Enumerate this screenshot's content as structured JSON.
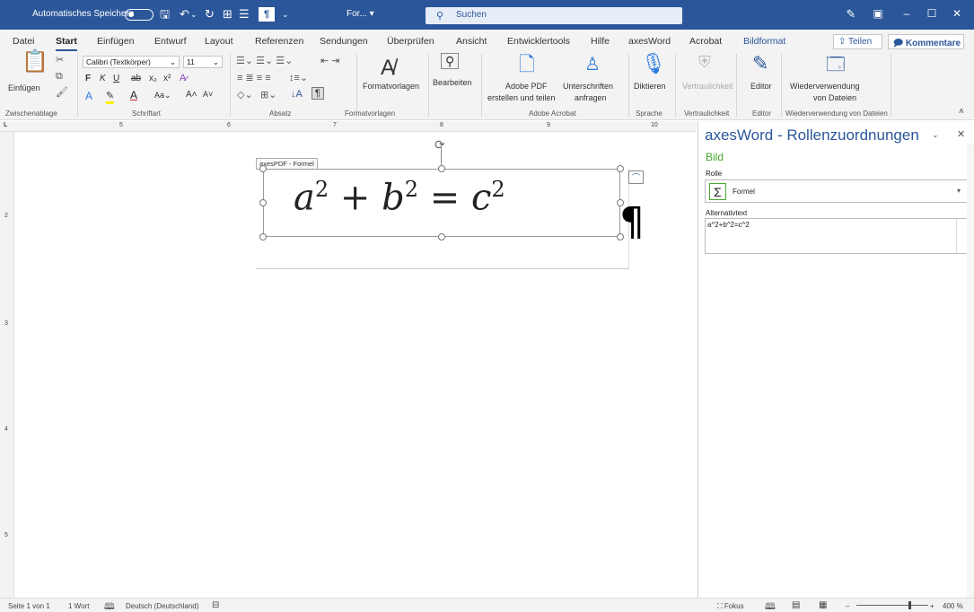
{
  "titlebar": {
    "autosave_label": "Automatisches Speichern",
    "doc_name": "For...",
    "search_placeholder": "Suchen",
    "save_icon": "save-icon",
    "undo_icon": "undo-icon",
    "redo_icon": "redo-icon"
  },
  "tabs": {
    "items": [
      "Datei",
      "Start",
      "Einfügen",
      "Entwurf",
      "Layout",
      "Referenzen",
      "Sendungen",
      "Überprüfen",
      "Ansicht",
      "Entwicklertools",
      "Hilfe",
      "axesWord",
      "Acrobat",
      "Bildformat"
    ],
    "share": "Teilen",
    "comments": "Kommentare"
  },
  "ribbon": {
    "paste": "Einfügen",
    "font_name": "Calibri (Textkörper)",
    "font_size": "11",
    "format_templates": "Formatvorlagen",
    "edit": "Bearbeiten",
    "adobe_pdf": "Adobe PDF",
    "adobe_pdf2": "erstellen und teilen",
    "sign": "Unterschriften",
    "sign2": "anfragen",
    "dictate": "Diktieren",
    "confidential": "Vertraulichkeit",
    "editor": "Editor",
    "reuse": "Wiederverwendung",
    "reuse2": "von Dateien",
    "groups": {
      "clipboard": "Zwischenablage",
      "font": "Schriftart",
      "paragraph": "Absatz",
      "styles": "Formatvorlagen",
      "acrobat": "Adobe Acrobat",
      "speech": "Sprache",
      "confidential": "Vertraulichkeit",
      "editor": "Editor",
      "reuse": "Wiederverwendung von Dateien"
    }
  },
  "ruler": {
    "marks": [
      "5",
      "6",
      "7",
      "8",
      "9",
      "10"
    ],
    "vmarks": [
      "2",
      "3",
      "4",
      "5"
    ]
  },
  "document": {
    "control_tag": "axesPDF - Formel",
    "formula_a": "a",
    "formula_b": "b",
    "formula_c": "c",
    "exp": "2",
    "plus": "+",
    "equals": "=",
    "pilcrow": "¶"
  },
  "pane": {
    "title": "axesWord - Rollenzuordnungen",
    "section": "Bild",
    "role_label": "Rolle",
    "role_value": "Formel",
    "alt_label": "Alternativtext",
    "alt_value": "a^2+b^2=c^2"
  },
  "status": {
    "page": "Seite 1 von 1",
    "words": "1 Wort",
    "language": "Deutsch (Deutschland)",
    "focus": "Fokus",
    "zoom": "400 %"
  },
  "colors": {
    "accent": "#2b579a",
    "pane_green": "#4aa82e"
  }
}
